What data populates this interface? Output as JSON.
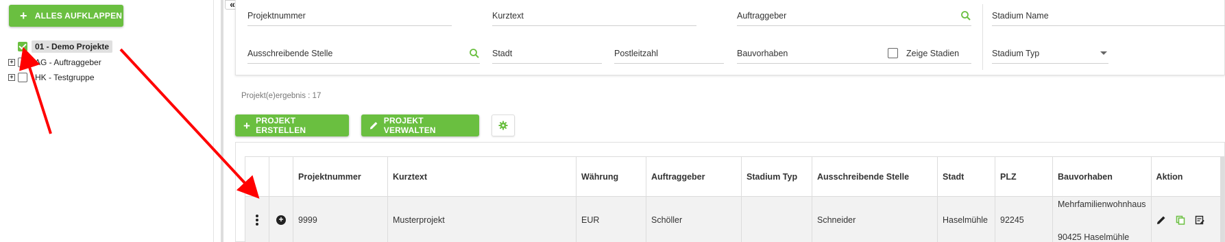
{
  "sidebar": {
    "expand_all_label": "ALLES AUFKLAPPEN",
    "tree": [
      {
        "label": "01 - Demo Projekte",
        "checked": true,
        "selected": true,
        "has_toggle": false
      },
      {
        "label": "AG - Auftraggeber",
        "checked": false,
        "selected": false,
        "has_toggle": true
      },
      {
        "label": "HK - Testgruppe",
        "checked": false,
        "selected": false,
        "has_toggle": true
      }
    ],
    "collapse_icon": "«"
  },
  "filters": {
    "projektnummer": "Projektnummer",
    "kurztext": "Kurztext",
    "auftraggeber": "Auftraggeber",
    "stadium_name": "Stadium Name",
    "ausschreibende_stelle": "Ausschreibende Stelle",
    "stadt": "Stadt",
    "postleitzahl": "Postleitzahl",
    "bauvorhaben": "Bauvorhaben",
    "stadium_typ": "Stadium Typ",
    "zeige_stadien": "Zeige Stadien"
  },
  "result_count": "Projekt(e)ergebnis : 17",
  "toolbar": {
    "create_label": "PROJEKT ERSTELLEN",
    "manage_label": "PROJEKT VERWALTEN"
  },
  "table": {
    "headers": [
      "",
      "",
      "Projektnummer",
      "Kurztext",
      "Währung",
      "Auftraggeber",
      "Stadium Typ",
      "Ausschreibende Stelle",
      "Stadt",
      "PLZ",
      "Bauvorhaben",
      "Aktion"
    ],
    "rows": [
      {
        "projektnummer": "9999",
        "kurztext": "Musterprojekt",
        "waehrung": "EUR",
        "auftraggeber": "Schöller",
        "stadium_typ": "",
        "ausschreibende_stelle": "Schneider",
        "stadt": "Haselmühle",
        "plz": "92245",
        "bauvorhaben_line1": "Mehrfamilienwohnhaus",
        "bauvorhaben_line2": "90425 Haselmühle"
      }
    ]
  },
  "colors": {
    "accent_green": "#6abf40",
    "arrow_red": "#ff0000"
  },
  "icons": [
    "plus-icon",
    "checkbox-icon",
    "collapse-icon",
    "search-icon",
    "dropdown-arrow-icon",
    "pencil-icon",
    "gear-icon",
    "kebab-menu-icon",
    "plus-circle-icon",
    "edit-icon",
    "copy-icon",
    "notes-icon"
  ]
}
